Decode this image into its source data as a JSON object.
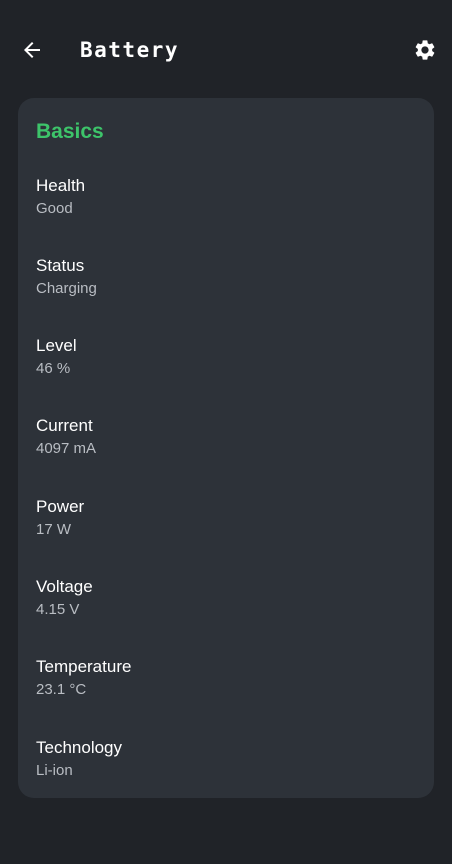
{
  "appbar": {
    "title": "Battery",
    "back_icon": "arrow-left-icon",
    "settings_icon": "gear-icon"
  },
  "colors": {
    "background": "#202328",
    "card": "#2d3239",
    "accent": "#3dc46a",
    "secondary_text": "#b9bdc3"
  },
  "section": {
    "title": "Basics",
    "items": [
      {
        "label": "Health",
        "value": "Good"
      },
      {
        "label": "Status",
        "value": "Charging"
      },
      {
        "label": "Level",
        "value": "46 %"
      },
      {
        "label": "Current",
        "value": "4097 mA"
      },
      {
        "label": "Power",
        "value": "17 W"
      },
      {
        "label": "Voltage",
        "value": "4.15 V"
      },
      {
        "label": "Temperature",
        "value": "23.1 °C"
      },
      {
        "label": "Technology",
        "value": "Li-ion"
      }
    ]
  }
}
